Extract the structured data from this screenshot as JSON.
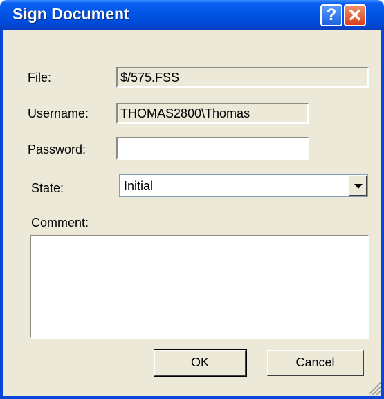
{
  "window": {
    "title": "Sign Document",
    "help_glyph": "?",
    "close_glyph": "✕"
  },
  "form": {
    "file_label": "File:",
    "file_value": "$/575.FSS",
    "username_label": "Username:",
    "username_value": "THOMAS2800\\Thomas",
    "password_label": "Password:",
    "password_value": "",
    "state_label": "State:",
    "state_selected": "Initial",
    "comment_label": "Comment:",
    "comment_value": ""
  },
  "buttons": {
    "ok_label": "OK",
    "cancel_label": "Cancel"
  },
  "colors": {
    "titlebar": "#0055e5",
    "window_bg": "#ece9d8",
    "close_button": "#d6401c"
  }
}
